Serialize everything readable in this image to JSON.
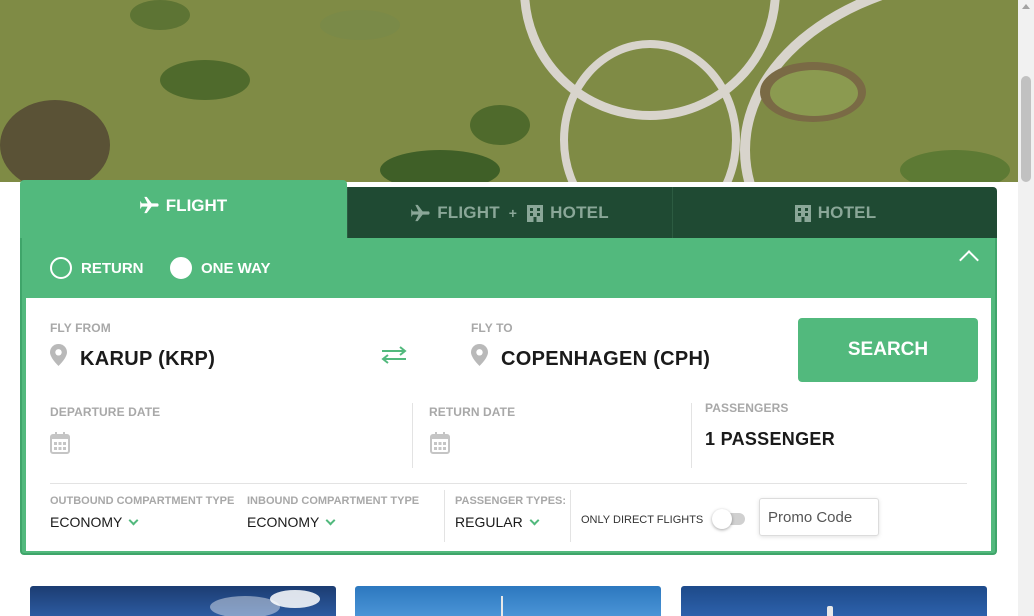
{
  "tabs": [
    {
      "label": "FLIGHT",
      "active": true,
      "icons": [
        "plane-icon"
      ]
    },
    {
      "label_a": "FLIGHT",
      "plus": "+",
      "label_b": "HOTEL",
      "active": false,
      "icons": [
        "plane-icon",
        "building-icon"
      ]
    },
    {
      "label": "HOTEL",
      "active": false,
      "icons": [
        "building-icon"
      ]
    }
  ],
  "trip_type": {
    "options": [
      "RETURN",
      "ONE WAY"
    ],
    "selected": "ONE WAY"
  },
  "fly_from": {
    "label": "FLY FROM",
    "value": "KARUP (KRP)"
  },
  "fly_to": {
    "label": "FLY TO",
    "value": "COPENHAGEN (CPH)"
  },
  "search_label": "SEARCH",
  "departure_date": {
    "label": "DEPARTURE DATE",
    "value": ""
  },
  "return_date": {
    "label": "RETURN DATE",
    "value": ""
  },
  "passengers": {
    "label": "PASSENGERS",
    "value": "1 PASSENGER"
  },
  "outbound_compartment": {
    "label": "OUTBOUND COMPARTMENT TYPE",
    "value": "ECONOMY"
  },
  "inbound_compartment": {
    "label": "INBOUND COMPARTMENT TYPE",
    "value": "ECONOMY"
  },
  "passenger_types": {
    "label": "PASSENGER TYPES:",
    "value": "REGULAR"
  },
  "direct_flights": {
    "label": "ONLY DIRECT FLIGHTS",
    "enabled": false
  },
  "promo": {
    "placeholder": "Promo Code"
  },
  "colors": {
    "accent": "#52b97d",
    "tab_bar": "#1f4a33",
    "text": "#1a1a1a",
    "label": "#a8a8a8"
  }
}
